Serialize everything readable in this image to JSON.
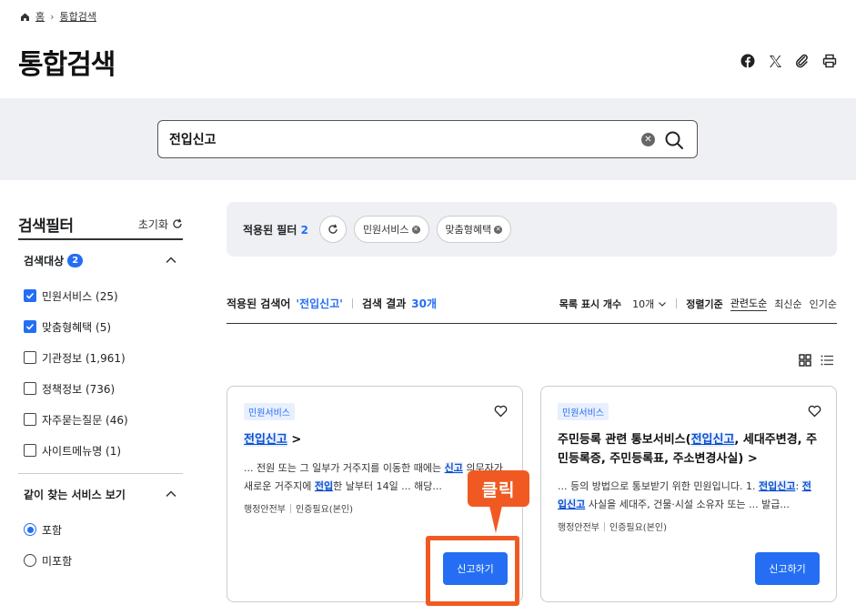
{
  "breadcrumb": {
    "home": "홈",
    "current": "통합검색"
  },
  "page": {
    "title": "통합검색"
  },
  "search": {
    "value": "전입신고"
  },
  "sidebar": {
    "title": "검색필터",
    "reset_label": "초기화",
    "target_section": {
      "title": "검색대상",
      "badge": "2",
      "options": [
        {
          "label": "민원서비스 (25)",
          "checked": true
        },
        {
          "label": "맞춤형혜택 (5)",
          "checked": true
        },
        {
          "label": "기관정보 (1,961)",
          "checked": false
        },
        {
          "label": "정책정보 (736)",
          "checked": false
        },
        {
          "label": "자주묻는질문 (46)",
          "checked": false
        },
        {
          "label": "사이트메뉴명 (1)",
          "checked": false
        }
      ]
    },
    "related_section": {
      "title": "같이 찾는 서비스 보기",
      "options": [
        {
          "label": "포함",
          "selected": true
        },
        {
          "label": "미포함",
          "selected": false
        }
      ]
    }
  },
  "applied_filter": {
    "label": "적용된 필터",
    "count": "2",
    "chips": [
      "민원서비스",
      "맞춤형혜택"
    ]
  },
  "result_bar": {
    "keyword_label": "적용된 검색어",
    "keyword": "'전입신고'",
    "result_label": "검색 결과",
    "result_count": "30개",
    "list_count_label": "목록 표시 개수",
    "list_count_value": "10개",
    "sort_label": "정렬기준",
    "sort_options": [
      "관련도순",
      "최신순",
      "인기순"
    ]
  },
  "cards": [
    {
      "tag": "민원서비스",
      "title_hl": "전입신고",
      "title_arrow": ">",
      "desc_parts": [
        "... 전원 또는 그 일부가 거주지를 이동한 때에는 ",
        "신고",
        " 의무자가 새로운 거주지에 ",
        "전입",
        "한 날부터 14일 ... 해당..."
      ],
      "org": "행정안전부",
      "auth": "인증필요(본인)",
      "button": "신고하기"
    },
    {
      "tag": "민원서비스",
      "title_pre": "주민등록 관련 통보서비스(",
      "title_hl": "전입신고",
      "title_post": ", 세대주변경, 주민등록증, 주민등록표, 주소변경사실)",
      "title_arrow": ">",
      "desc_parts": [
        "... 등의 방법으로 통보받기 위한 민원입니다. 1. ",
        "전입신고",
        ": ",
        "전입신고",
        " 사실을 세대주, 건물·시설 소유자 또는 ... 발급..."
      ],
      "org": "행정안전부",
      "auth": "인증필요(본인)",
      "button": "신고하기"
    }
  ],
  "annotation": {
    "label": "클릭"
  },
  "colors": {
    "primary": "#256ef4",
    "annotation": "#f05a22",
    "band": "#eef0f4"
  }
}
